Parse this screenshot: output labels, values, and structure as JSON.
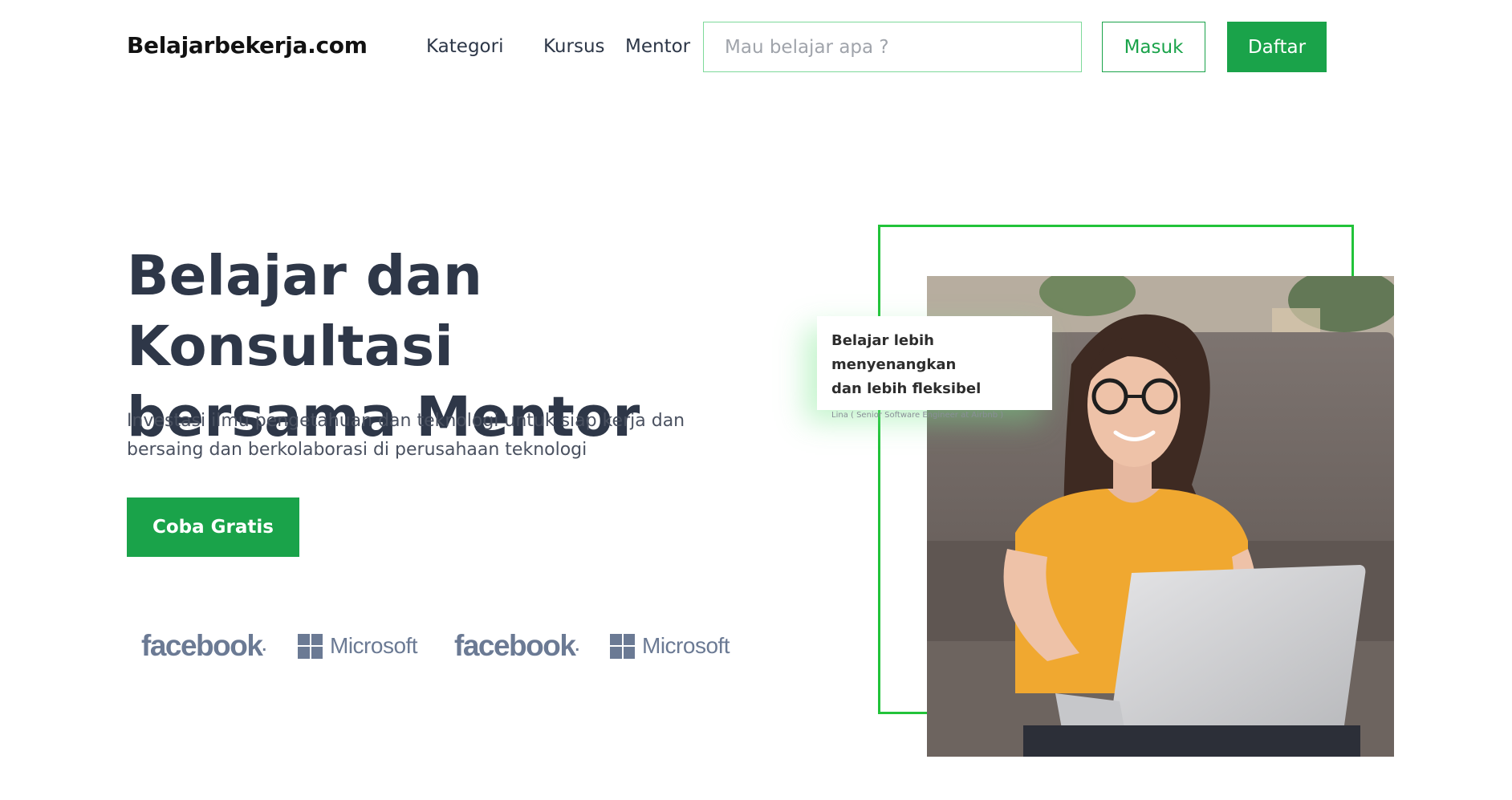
{
  "header": {
    "brand": "Belajarbekerja.com",
    "nav": [
      "Kategori",
      "Kursus",
      "Mentor"
    ],
    "search_placeholder": "Mau belajar apa ?",
    "login_label": "Masuk",
    "register_label": "Daftar"
  },
  "hero": {
    "title_line1": "Belajar dan Konsultasi",
    "title_line2": "bersama Mentor",
    "subtitle_line1": "Investasi ilmu pengetahuan dan teknologi untuk siap kerja dan",
    "subtitle_line2": "bersaing dan berkolaborasi di perusahaan teknologi",
    "cta_label": "Coba Gratis"
  },
  "partners": [
    {
      "name": "facebook",
      "suffix": "."
    },
    {
      "name": "Microsoft"
    },
    {
      "name": "facebook",
      "suffix": "."
    },
    {
      "name": "Microsoft"
    }
  ],
  "testimonial": {
    "line1": "Belajar lebih menyenangkan",
    "line2": "dan lebih fleksibel",
    "author": "Lina ( Senior Software Engineer at Airbnb )"
  },
  "colors": {
    "accent": "#1aa34a",
    "frame": "#22c33a",
    "heading": "#2e3748",
    "logo_gray": "#6b7a94"
  }
}
